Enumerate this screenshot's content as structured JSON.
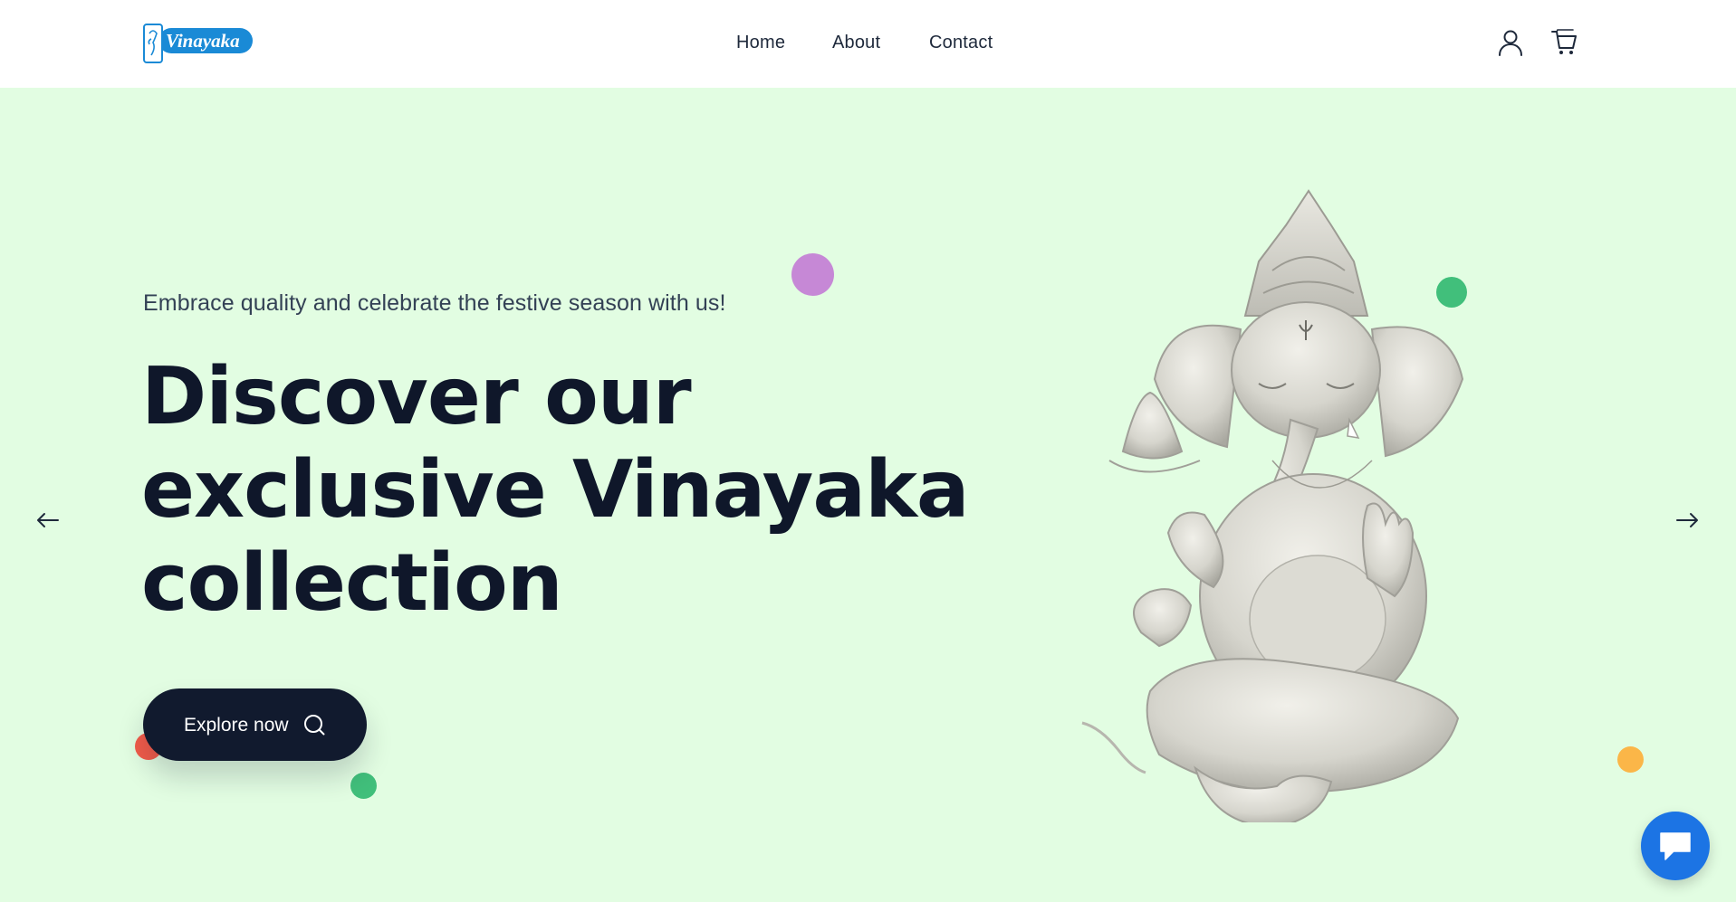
{
  "header": {
    "logo_text": "Vinayaka",
    "nav": [
      {
        "label": "Home"
      },
      {
        "label": "About"
      },
      {
        "label": "Contact"
      }
    ],
    "icons": {
      "account": "user-icon",
      "cart": "cart-icon"
    }
  },
  "hero": {
    "tagline": "Embrace quality and celebrate the festive season with us!",
    "headline_lines": [
      "Discover our",
      "exclusive Vinayaka",
      "collection"
    ],
    "cta_label": "Explore now",
    "cta_icon": "search-icon",
    "prev_icon": "arrow-left-icon",
    "next_icon": "arrow-right-icon",
    "image": "ganesha-idol-image"
  },
  "chat": {
    "icon": "chat-bubble-icon"
  },
  "colors": {
    "hero_bg": "#e2fde2",
    "heading": "#0f172a",
    "cta_bg": "#111a2e",
    "chat_bg": "#1c74e4",
    "logo_blue": "#1a8ad6"
  }
}
